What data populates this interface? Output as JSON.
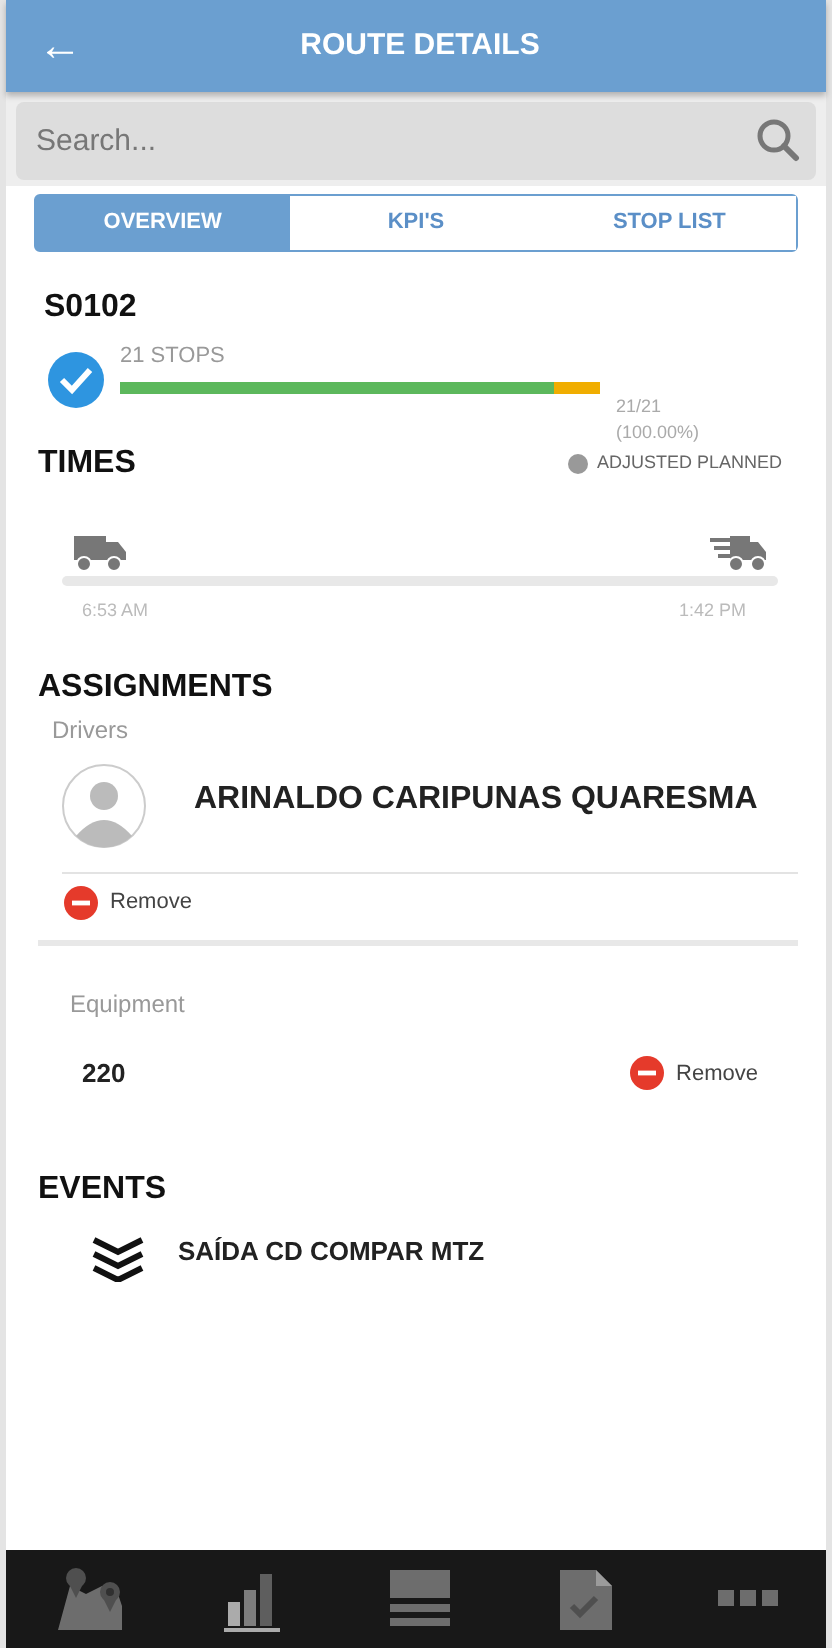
{
  "header": {
    "back_icon": "←",
    "title": "ROUTE DETAILS"
  },
  "search": {
    "placeholder": "Search..."
  },
  "tabs": [
    {
      "label": "OVERVIEW",
      "selected": true
    },
    {
      "label": "KPI'S",
      "selected": false
    },
    {
      "label": "STOP LIST",
      "selected": false
    }
  ],
  "route": {
    "code": "S0102",
    "completed": true,
    "stops_label": "21 STOPS",
    "progress": [
      {
        "color": "#5cb85c",
        "level": 0.904
      },
      {
        "color": "#f0ad00",
        "level": 0.096
      }
    ],
    "count": "21/21",
    "percent": "(100.00%)"
  },
  "times": {
    "title": "TIMES",
    "legend": [
      {
        "label": "ADJUSTED PLANNED",
        "color": "#999999"
      }
    ],
    "start": "6:53 AM",
    "end": "1:42 PM"
  },
  "assignments": {
    "title": "ASSIGNMENTS",
    "drivers_label": "Drivers",
    "drivers": [
      {
        "name": "ARINALDO CARIPUNAS QUARESMA",
        "action": "Remove"
      }
    ],
    "equipment_label": "Equipment",
    "equipment": [
      {
        "name": "220",
        "action": "Remove"
      }
    ]
  },
  "events": {
    "title": "EVENTS",
    "items": [
      {
        "label": "SAÍDA CD COMPAR MTZ"
      }
    ]
  },
  "bottom_nav": [
    {
      "kind": "map",
      "selected": false
    },
    {
      "kind": "chart",
      "selected": false
    },
    {
      "kind": "list",
      "selected": false
    },
    {
      "kind": "doc",
      "selected": false
    },
    {
      "kind": "more",
      "selected": false
    }
  ]
}
